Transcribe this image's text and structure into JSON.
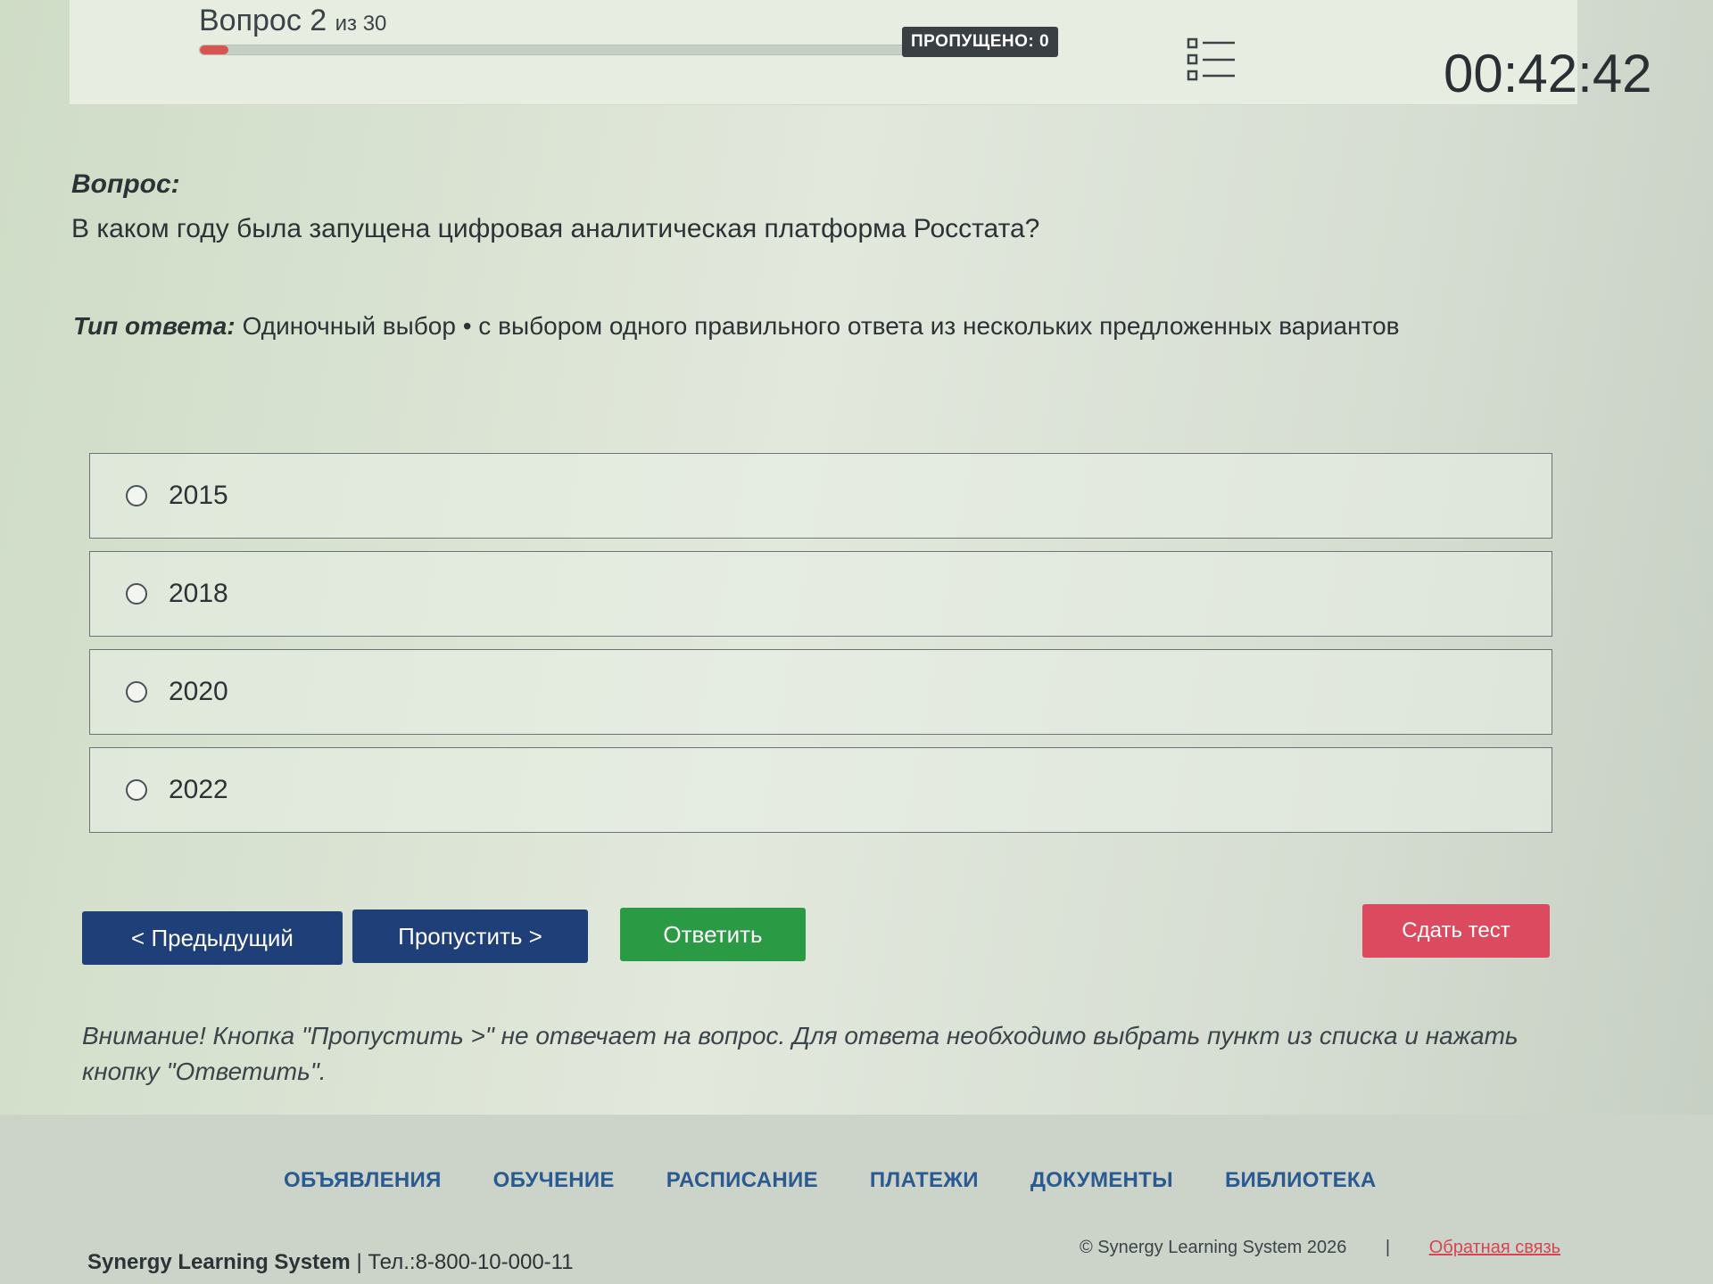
{
  "header": {
    "question_prefix": "Вопрос 2",
    "question_of": "из 30",
    "progress": 0.033,
    "skipped_label": "ПРОПУЩЕНО: 0",
    "timer": "00:42:42"
  },
  "question": {
    "heading": "Вопрос:",
    "text": "В каком году была запущена цифровая аналитическая платформа Росстата?",
    "answer_type_label": "Тип ответа:",
    "answer_type_value": "Одиночный выбор • с выбором одного правильного ответа из нескольких предложенных вариантов"
  },
  "options": [
    "2015",
    "2018",
    "2020",
    "2022"
  ],
  "buttons": {
    "prev": "< Предыдущий",
    "skip": "Пропустить >",
    "answer": "Ответить",
    "submit": "Сдать тест"
  },
  "warning": "Внимание! Кнопка \"Пропустить >\" не отвечает на вопрос. Для ответа необходимо выбрать пункт из списка и нажать кнопку \"Ответить\".",
  "footer": {
    "nav": [
      "ОБЪЯВЛЕНИЯ",
      "ОБУЧЕНИЕ",
      "РАСПИСАНИЕ",
      "ПЛАТЕЖИ",
      "ДОКУМЕНТЫ",
      "БИБЛИОТЕКА"
    ],
    "brand": "Synergy Learning System",
    "phone": "Тел.:8-800-10-000-11",
    "copyright": "© Synergy Learning System 2026",
    "feedback": "Обратная связь"
  },
  "colors": {
    "primary_button": "#1f3f78",
    "answer_button": "#2a9a45",
    "submit_button": "#dc4a60",
    "progress_fill": "#d9534f"
  }
}
